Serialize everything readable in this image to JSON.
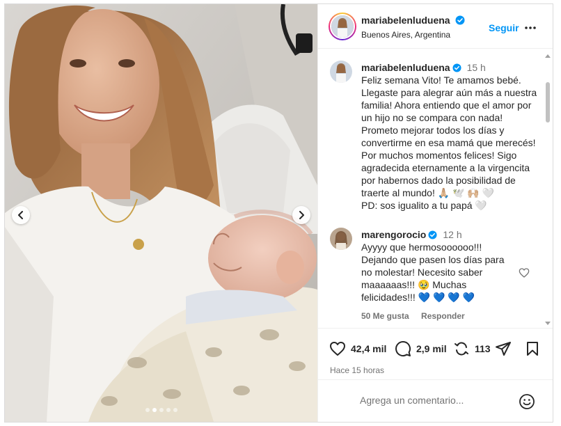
{
  "header": {
    "username": "mariabelenluduena",
    "location": "Buenos Aires, Argentina",
    "follow_label": "Seguir"
  },
  "caption": {
    "username": "mariabelenluduena",
    "time": "15 h",
    "lines": [
      "Feliz semana Vito! Te amamos bebé.",
      "Llegaste para alegrar aún más a nuestra",
      "familia! Ahora entiendo que el amor por",
      "un hijo no se compara con nada!",
      "Prometo mejorar todos los días y",
      "convertirme en esa mamá que merecés!",
      "Por muchos momentos felices! Sigo",
      "agradecida eternamente a la virgencita",
      "por habernos  dado la posibilidad de",
      "traerte al mundo! 🙏🏼 🕊️ 🙌🏼 🤍",
      "PD: sos igualito a tu papá 🤍"
    ]
  },
  "comment": {
    "username": "marengorocio",
    "time": "12 h",
    "lines": [
      "Ayyyy que hermosoooooo!!!",
      "Dejando que pasen los días para",
      "no molestar! Necesito saber",
      "maaaaaas!!! 🥹  Muchas",
      "felicidades!!! 💙 💙 💙 💙"
    ],
    "likes_label": "50 Me gusta",
    "reply_label": "Responder"
  },
  "actions": {
    "likes": "42,4 mil",
    "comments": "2,9 mil",
    "reposts": "113",
    "posted_ago": "Hace 15 horas"
  },
  "composer": {
    "placeholder": "Agrega un comentario..."
  },
  "carousel": {
    "slide_count": 5,
    "active_index": 1
  },
  "colors": {
    "link_blue": "#0095f6",
    "verified_blue": "#0095f6",
    "muted_text": "#737373",
    "border": "#dbdbdb"
  },
  "icons": [
    "chevron-left-icon",
    "chevron-right-icon",
    "verified-icon",
    "more-icon",
    "heart-icon",
    "comment-icon",
    "repost-icon",
    "share-icon",
    "save-icon",
    "emoji-icon"
  ]
}
